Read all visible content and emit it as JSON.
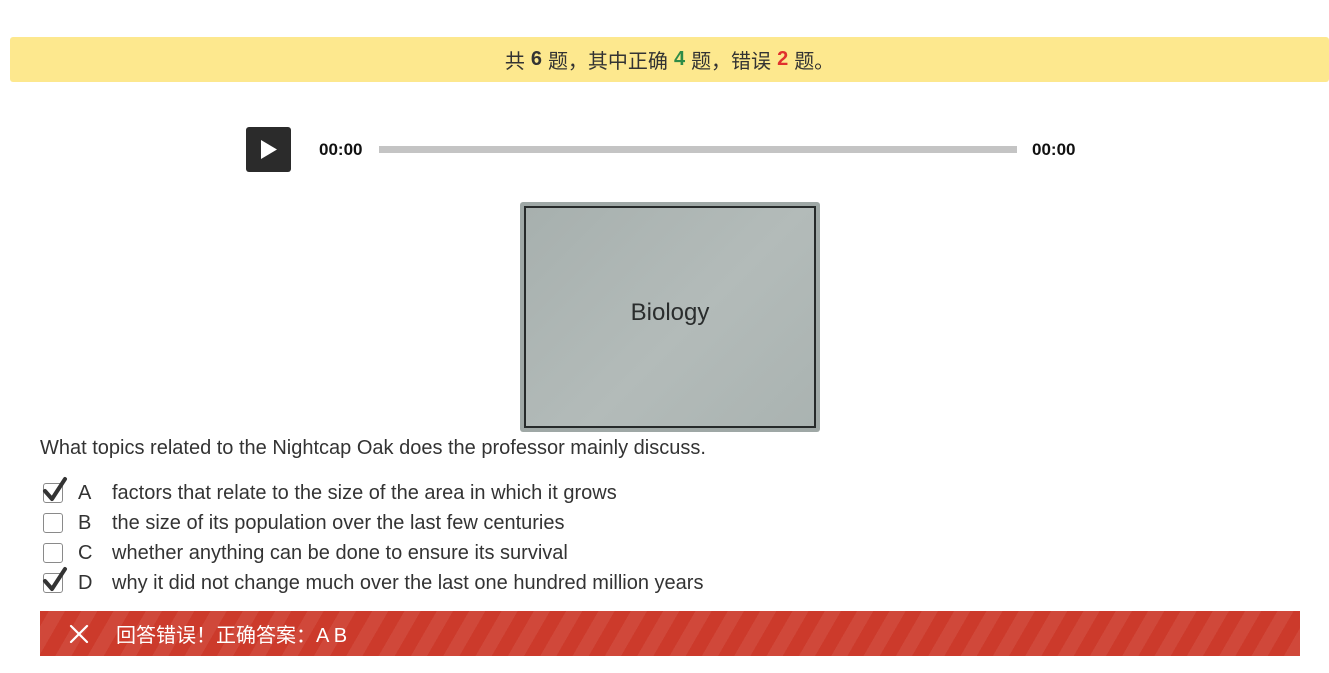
{
  "summary": {
    "prefix": "共",
    "total": "6",
    "middle": "题，其中正确",
    "correct": "4",
    "middle2": "题，错误",
    "wrong": "2",
    "suffix": "题。"
  },
  "player": {
    "current_time": "00:00",
    "total_time": "00:00",
    "play_icon": "play-icon"
  },
  "slide": {
    "title": "Biology"
  },
  "question": {
    "text": "What topics related to the Nightcap Oak does the professor mainly discuss."
  },
  "options": [
    {
      "letter": "A",
      "text": "factors that relate to the size of the area in which it grows",
      "checked": true
    },
    {
      "letter": "B",
      "text": "the size of its population over the last few centuries",
      "checked": false
    },
    {
      "letter": "C",
      "text": "whether anything can be done to ensure its survival",
      "checked": false
    },
    {
      "letter": "D",
      "text": "why it did not change much over the last one hundred million years",
      "checked": true
    }
  ],
  "result": {
    "icon": "close-icon",
    "text": "回答错误！正确答案：A B"
  },
  "colors": {
    "summary_bg": "#fde88e",
    "correct_count": "#2e8b47",
    "wrong_count": "#e0312d",
    "result_bg": "#cc3a2b"
  }
}
